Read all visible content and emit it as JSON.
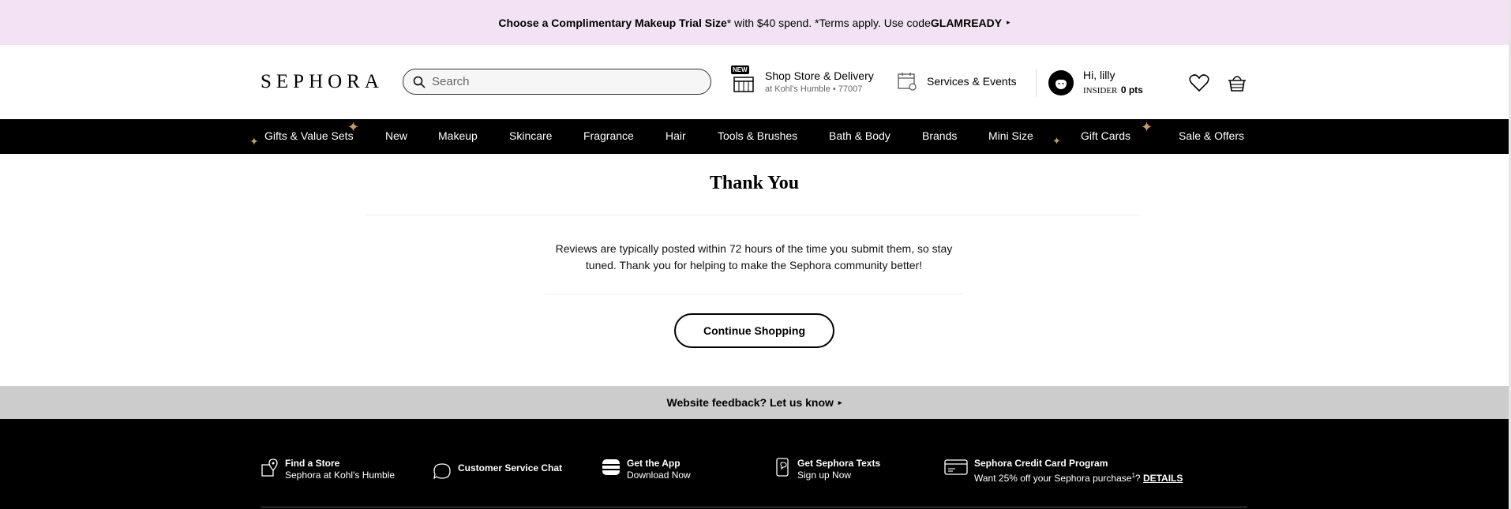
{
  "promo": {
    "bold1": "Choose a Complimentary Makeup Trial Size",
    "text": "* with $40 spend. *Terms apply. Use code ",
    "code": "GLAMREADY",
    "arrow": "▸"
  },
  "header": {
    "logo": "SEPHORA",
    "search_placeholder": "Search",
    "shop_store": {
      "badge": "NEW",
      "line1": "Shop Store & Delivery",
      "line2": "at Kohl's Humble • 77007"
    },
    "services": "Services & Events",
    "user": {
      "greeting": "Hi, lilly",
      "insider": "INSIDER",
      "points": "0 pts"
    }
  },
  "nav": {
    "items": [
      "Gifts & Value Sets",
      "New",
      "Makeup",
      "Skincare",
      "Fragrance",
      "Hair",
      "Tools & Brushes",
      "Bath & Body",
      "Brands",
      "Mini Size",
      "Gift Cards",
      "Sale & Offers"
    ]
  },
  "content": {
    "title": "Thank You",
    "message": "Reviews are typically posted within 72 hours of the time you submit them, so stay tuned. Thank you for helping to make the Sephora community better!",
    "button": "Continue Shopping"
  },
  "feedback": {
    "text": "Website feedback? Let us know",
    "arrow": "▸"
  },
  "footer": {
    "find_store": {
      "title": "Find a Store",
      "sub": "Sephora at Kohl's Humble"
    },
    "chat": {
      "title": "Customer Service Chat"
    },
    "app": {
      "title": "Get the App",
      "sub": "Download Now"
    },
    "texts": {
      "title": "Get Sephora Texts",
      "sub": "Sign up Now"
    },
    "credit": {
      "title": "Sephora Credit Card Program",
      "sub": "Want 25% off your Sephora purchase",
      "sup": "1",
      "q": "?",
      "details": "DETAILS"
    }
  },
  "colors": {
    "promo_bg": "#f3e2f3",
    "nav_bg": "#000000",
    "sparkle": "#c89b5b",
    "feedback_bg": "#cccccc"
  }
}
